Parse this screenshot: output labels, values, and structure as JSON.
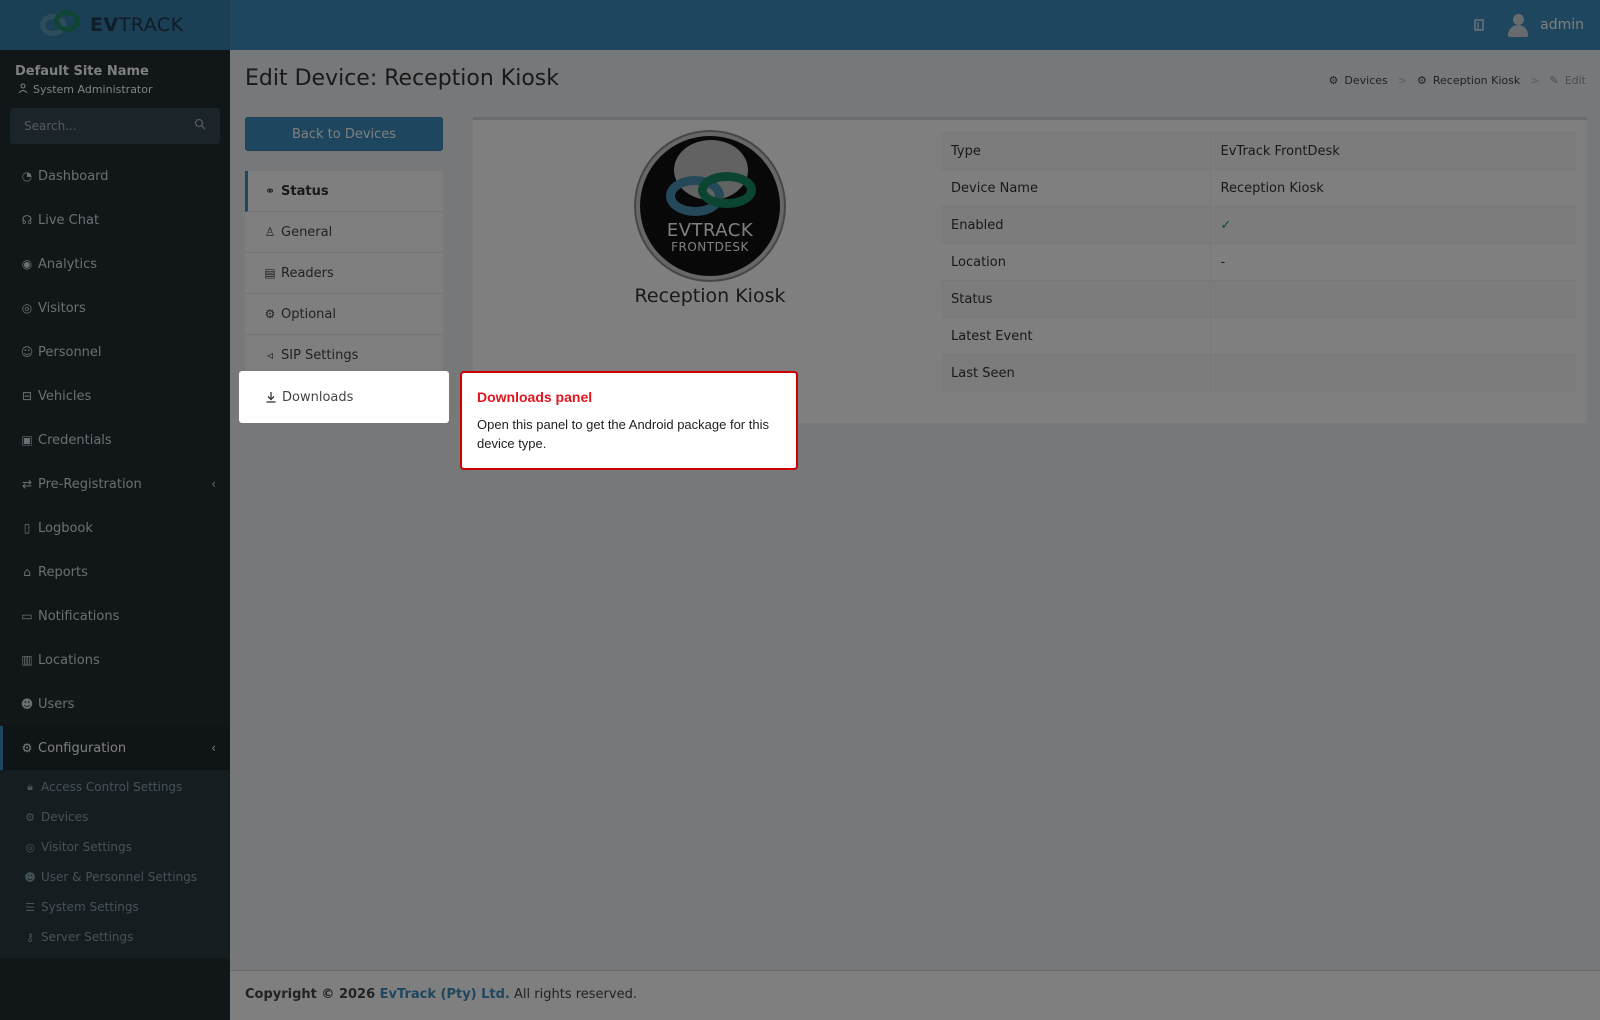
{
  "app": {
    "logo_text_bold": "EV",
    "logo_text": "TRACK",
    "user_name": "admin"
  },
  "sidebar": {
    "site_name": "Default Site Name",
    "role": "System Administrator",
    "search_placeholder": "Search...",
    "items": [
      {
        "label": "Dashboard",
        "icon": "dashboard-icon"
      },
      {
        "label": "Live Chat",
        "icon": "headset-icon"
      },
      {
        "label": "Analytics",
        "icon": "target-icon"
      },
      {
        "label": "Visitors",
        "icon": "eye-icon"
      },
      {
        "label": "Personnel",
        "icon": "user-icon"
      },
      {
        "label": "Vehicles",
        "icon": "car-icon"
      },
      {
        "label": "Credentials",
        "icon": "id-card-icon"
      },
      {
        "label": "Pre-Registration",
        "icon": "arrows-icon"
      },
      {
        "label": "Logbook",
        "icon": "book-icon"
      },
      {
        "label": "Reports",
        "icon": "chart-icon"
      },
      {
        "label": "Notifications",
        "icon": "chat-icon"
      },
      {
        "label": "Locations",
        "icon": "map-icon"
      },
      {
        "label": "Users",
        "icon": "users-icon"
      },
      {
        "label": "Configuration",
        "icon": "gear-icon"
      }
    ],
    "sub_items": [
      {
        "label": "Access Control Settings",
        "icon": "lock-icon"
      },
      {
        "label": "Devices",
        "icon": "cog-icon"
      },
      {
        "label": "Visitor Settings",
        "icon": "eye-icon"
      },
      {
        "label": "User & Personnel Settings",
        "icon": "users-icon"
      },
      {
        "label": "System Settings",
        "icon": "sliders-icon"
      },
      {
        "label": "Server Settings",
        "icon": "key-icon"
      }
    ]
  },
  "page": {
    "title": "Edit Device: Reception Kiosk",
    "breadcrumb": [
      "Devices",
      "Reception Kiosk",
      "Edit"
    ],
    "back_label": "Back to Devices",
    "tabs": [
      "Status",
      "General",
      "Readers",
      "Optional",
      "SIP Settings",
      "Downloads"
    ]
  },
  "device": {
    "image_line1": "EVTRACK",
    "image_line2": "FRONTDESK",
    "caption": "Reception Kiosk",
    "rows": [
      {
        "key": "Type",
        "value": "EvTrack FrontDesk"
      },
      {
        "key": "Device Name",
        "value": "Reception Kiosk"
      },
      {
        "key": "Enabled",
        "value": "✓"
      },
      {
        "key": "Location",
        "value": "-"
      },
      {
        "key": "Status",
        "value": ""
      },
      {
        "key": "Latest Event",
        "value": ""
      },
      {
        "key": "Last Seen",
        "value": ""
      }
    ]
  },
  "footer": {
    "prefix": "Copyright © 2026 ",
    "company": "EvTrack (Pty) Ltd.",
    "suffix": " All rights reserved."
  },
  "tooltip": {
    "title": "Downloads panel",
    "body": "Open this panel to get the Android package for this device type."
  },
  "colors": {
    "header": "#3c8dbc",
    "sidebar": "#222d32",
    "tooltip_border": "#cc0000",
    "tooltip_title": "#e0161f"
  }
}
